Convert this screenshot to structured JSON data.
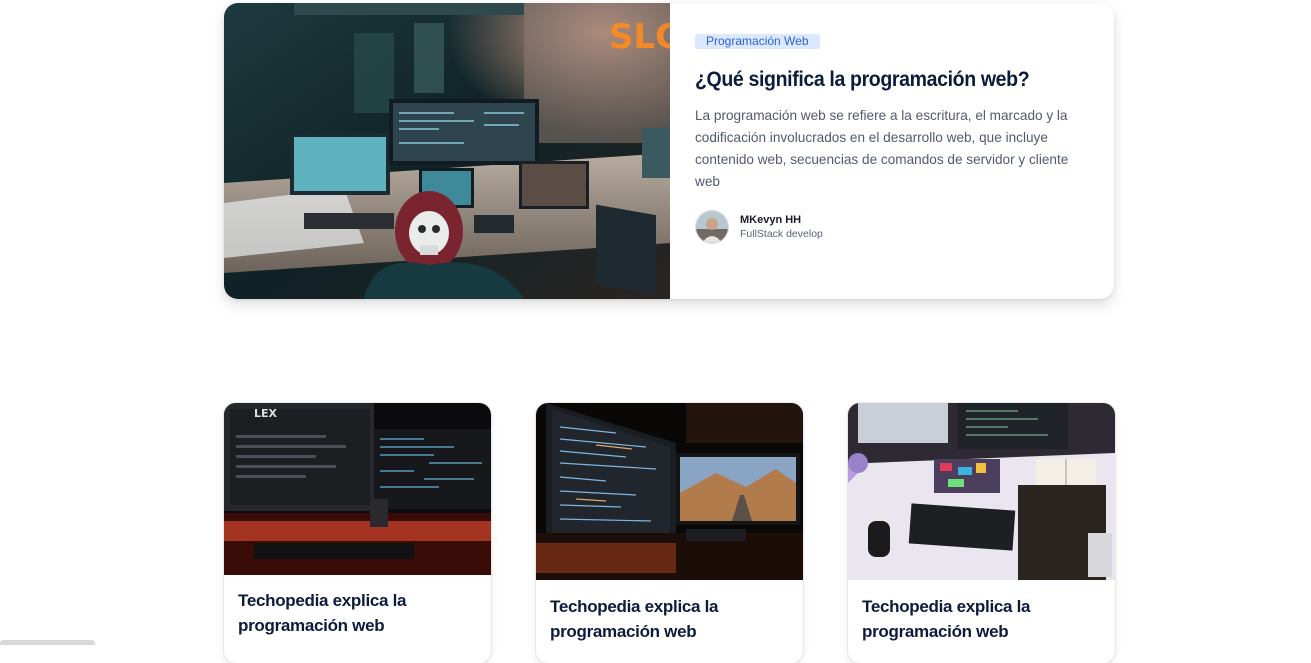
{
  "featured": {
    "image_alt": "hacker-desk-photo",
    "badge": "Programación Web",
    "title": "¿Qué significa la programación web?",
    "description": "La programación web se refiere a la escritura, el marcado y la codificación involucrados en el desarrollo web, que incluye contenido web, secuencias de comandos de servidor y cliente web",
    "author": {
      "name": "MKevyn HH",
      "role": "FullStack develop"
    }
  },
  "cards": [
    {
      "title": "Techopedia explica la programación web"
    },
    {
      "title": "Techopedia explica la programación web"
    },
    {
      "title": "Techopedia explica la programación web"
    }
  ]
}
